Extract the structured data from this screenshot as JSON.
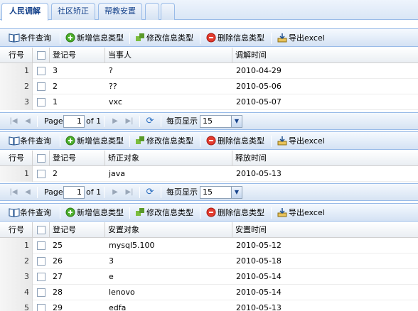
{
  "tabs": [
    {
      "label": "人民调解"
    },
    {
      "label": "社区矫正"
    },
    {
      "label": "帮教安置"
    },
    {
      "label": ""
    },
    {
      "label": ""
    }
  ],
  "toolbar": {
    "query_label": "条件查询",
    "add_label": "新增信息类型",
    "edit_label": "修改信息类型",
    "delete_label": "删除信息类型",
    "export_label": "导出excel"
  },
  "pager": {
    "page_label": "Page",
    "page_value": "1",
    "of_label": "of 1",
    "per_page_label": "每页显示",
    "per_page_value": "15"
  },
  "sections": [
    {
      "headers": [
        "行号",
        "登记号",
        "当事人",
        "调解时间"
      ],
      "rows": [
        {
          "num": "1",
          "id": "3",
          "name": "?",
          "date": "2010-04-29"
        },
        {
          "num": "2",
          "id": "2",
          "name": "??",
          "date": "2010-05-06"
        },
        {
          "num": "3",
          "id": "1",
          "name": "vxc",
          "date": "2010-05-07"
        }
      ]
    },
    {
      "headers": [
        "行号",
        "登记号",
        "矫正对象",
        "释放时间"
      ],
      "rows": [
        {
          "num": "1",
          "id": "2",
          "name": "java",
          "date": "2010-05-13"
        }
      ]
    },
    {
      "headers": [
        "行号",
        "登记号",
        "安置对象",
        "安置时间"
      ],
      "rows": [
        {
          "num": "1",
          "id": "25",
          "name": "mysql5.100",
          "date": "2010-05-12"
        },
        {
          "num": "2",
          "id": "26",
          "name": "3",
          "date": "2010-05-18"
        },
        {
          "num": "3",
          "id": "27",
          "name": "e",
          "date": "2010-05-14"
        },
        {
          "num": "4",
          "id": "28",
          "name": "lenovo",
          "date": "2010-05-14"
        },
        {
          "num": "5",
          "id": "29",
          "name": "edfa",
          "date": "2010-05-13"
        }
      ]
    }
  ]
}
